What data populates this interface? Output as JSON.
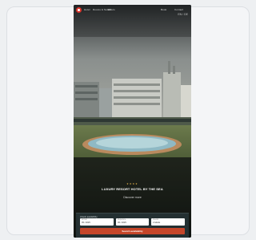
{
  "nav": {
    "items": [
      "Hotel",
      "Rooms & Suites",
      "Offers"
    ],
    "right_items": [
      "Book",
      "Contact"
    ],
    "language": "EN / DE"
  },
  "hero": {
    "rating": "★★★★",
    "headline": "LUXURY RESORT HOTEL BY THE SEA",
    "subline": "Discover more"
  },
  "booking": {
    "label": "Check availability",
    "fields": [
      {
        "label": "Arrival",
        "value": "05 / 2025"
      },
      {
        "label": "Departure",
        "value": "06 / 2025"
      },
      {
        "label": "Guests",
        "value": "2 Adults"
      }
    ],
    "button": "Search availability"
  },
  "colors": {
    "accent": "#c5462a",
    "brand_red": "#d9342b"
  }
}
